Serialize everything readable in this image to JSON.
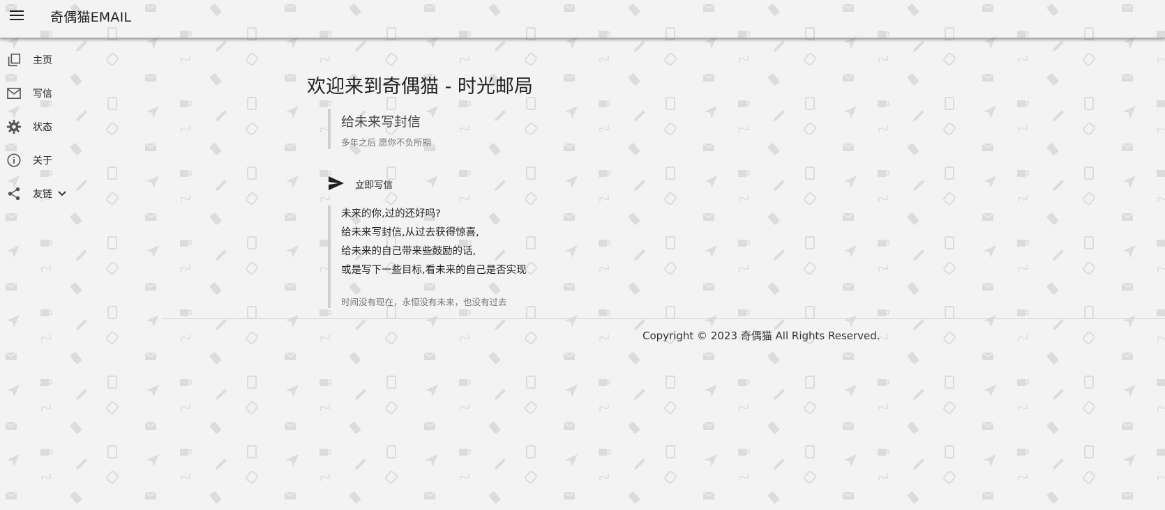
{
  "app": {
    "title": "奇偶猫EMAIL"
  },
  "sidebar": {
    "items": [
      {
        "label": "主页",
        "icon": "copy-icon"
      },
      {
        "label": "写信",
        "icon": "mail-icon"
      },
      {
        "label": "状态",
        "icon": "gear-icon"
      },
      {
        "label": "关于",
        "icon": "info-icon"
      },
      {
        "label": "友链",
        "icon": "share-icon"
      }
    ]
  },
  "main": {
    "heading": "欢迎来到奇偶猫 - 时光邮局",
    "intro": {
      "title": "给未来写封信",
      "subtitle": "多年之后 愿你不负所期"
    },
    "write_button": {
      "label": "立即写信",
      "icon": "send-icon"
    },
    "quote": {
      "lines": [
        "未来的你,过的还好吗?",
        "给未来写封信,从过去获得惊喜,",
        "给未来的自己带来些鼓励的话,",
        "或是写下一些目标,看未来的自己是否实现"
      ],
      "footer": "时间没有现在，永恒没有未来，也没有过去"
    }
  },
  "footer": {
    "copyright": "Copyright © 2023 奇偶猫 All Rights Reserved."
  },
  "colors": {
    "background": "#f3f3f3",
    "pattern": "#dedede",
    "text": "#212121",
    "muted": "#757575",
    "quote_border": "#d0d0d0"
  }
}
